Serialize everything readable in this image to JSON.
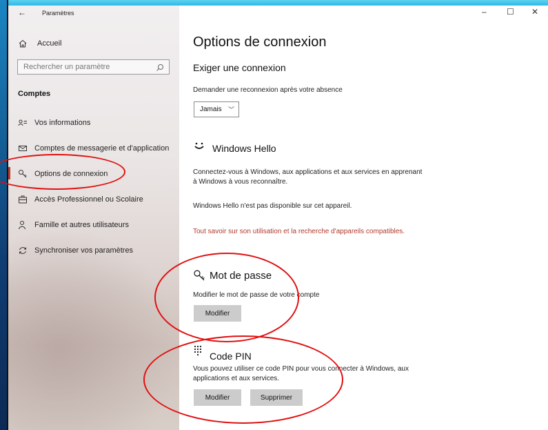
{
  "window": {
    "app_title": "Paramètres",
    "minimize": "–",
    "maximize": "☐",
    "close": "✕"
  },
  "sidebar": {
    "home_label": "Accueil",
    "search_placeholder": "Rechercher un paramètre",
    "section": "Comptes",
    "items": [
      {
        "label": "Vos informations",
        "icon": "person-card-icon"
      },
      {
        "label": "Comptes de messagerie et d'application",
        "icon": "mail-icon"
      },
      {
        "label": "Options de connexion",
        "icon": "key-icon",
        "active": true
      },
      {
        "label": "Accès Professionnel ou Scolaire",
        "icon": "briefcase-icon"
      },
      {
        "label": "Famille et autres utilisateurs",
        "icon": "person-add-icon"
      },
      {
        "label": "Synchroniser vos paramètres",
        "icon": "sync-icon"
      }
    ]
  },
  "main": {
    "title": "Options de connexion",
    "require_signin": {
      "heading": "Exiger une connexion",
      "description": "Demander une reconnexion après votre absence",
      "dropdown_value": "Jamais"
    },
    "hello": {
      "heading": "Windows Hello",
      "description": "Connectez-vous à Windows, aux applications et aux services en apprenant à Windows à vous reconnaître.",
      "unavailable": "Windows Hello n'est pas disponible sur cet appareil.",
      "link": "Tout savoir sur son utilisation et la recherche d'appareils compatibles."
    },
    "password": {
      "heading": "Mot de passe",
      "description": "Modifier le mot de passe de votre compte",
      "button": "Modifier"
    },
    "pin": {
      "heading": "Code PIN",
      "description": "Vous pouvez utiliser ce code PIN pour vous connecter à Windows, aux applications et aux services.",
      "modify_button": "Modifier",
      "delete_button": "Supprimer"
    }
  },
  "colors": {
    "annotation": "#e10f0f",
    "link": "#b03a2e",
    "accent": "#c0392b"
  }
}
